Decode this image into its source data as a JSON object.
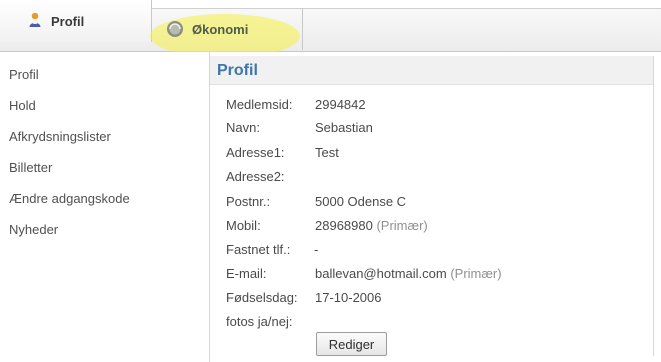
{
  "tabs": {
    "profile": "Profil",
    "economy": "Økonomi"
  },
  "sidebar": {
    "items": [
      "Profil",
      "Hold",
      "Afkrydsningslister",
      "Billetter",
      "Ændre adgangskode",
      "Nyheder"
    ]
  },
  "main": {
    "title": "Profil",
    "fields": [
      {
        "label": "Medlemsid:",
        "value": "2994842"
      },
      {
        "label": "Navn:",
        "value": "Sebastian"
      },
      {
        "label": "Adresse1:",
        "value": "Test"
      },
      {
        "label": "Adresse2:",
        "value": ""
      },
      {
        "label": "Postnr.:",
        "value": "5000 Odense C"
      },
      {
        "label": "Mobil:",
        "value": "28968980",
        "suffix": "(Primær)"
      },
      {
        "label": "Fastnet tlf.:",
        "value": "-"
      },
      {
        "label": "E-mail:",
        "value": "ballevan@hotmail.com",
        "suffix": "(Primær)"
      },
      {
        "label": "Fødselsdag:",
        "value": "17-10-2006"
      },
      {
        "label": "fotos ja/nej:",
        "value": ""
      }
    ],
    "button": "Rediger"
  },
  "icons": {
    "profile_tab": "person-icon",
    "economy_tab": "coin-icon"
  },
  "colors": {
    "accent": "#3f75ad",
    "highlight": "#f6f046"
  }
}
